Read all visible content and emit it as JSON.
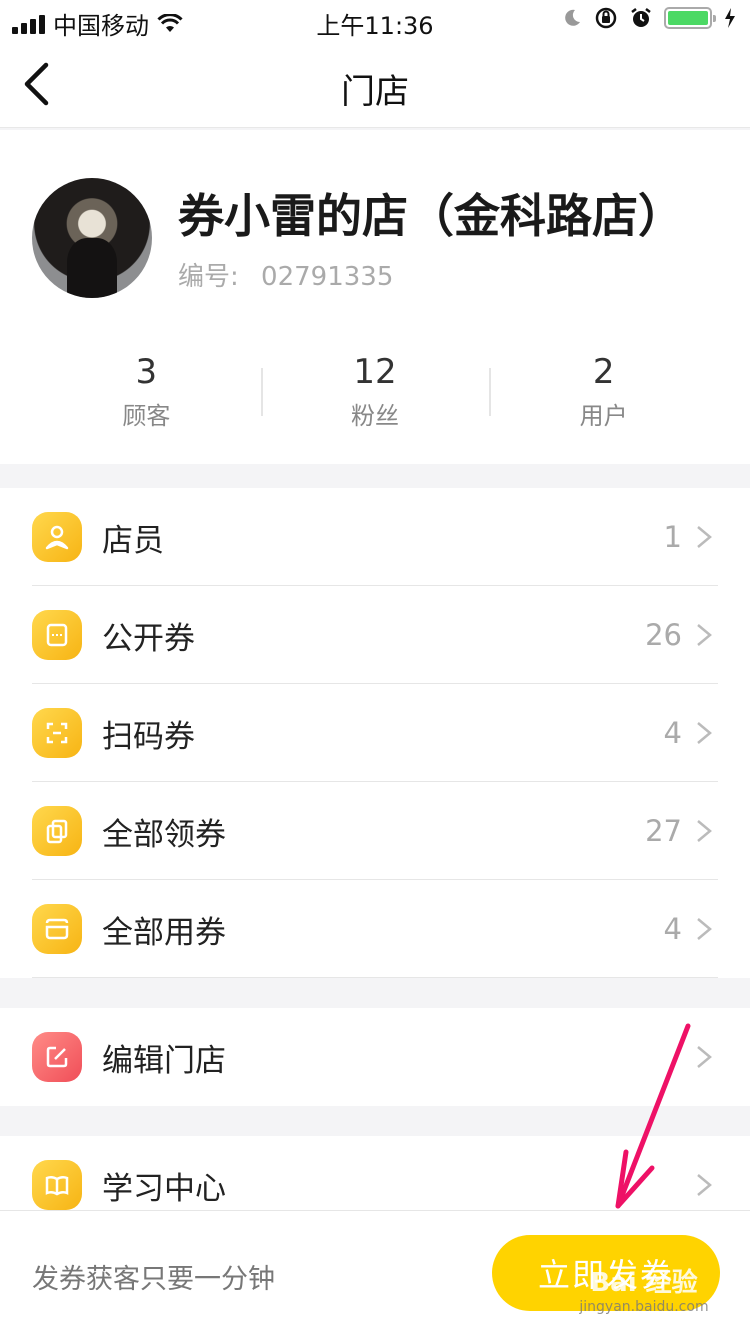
{
  "status_bar": {
    "carrier": "中国移动",
    "time": "上午11:36"
  },
  "nav": {
    "title": "门店"
  },
  "store": {
    "name": "券小雷的店（金科路店）",
    "id_label": "编号:",
    "id_value": "02791335",
    "stats": [
      {
        "value": "3",
        "label": "顾客"
      },
      {
        "value": "12",
        "label": "粉丝"
      },
      {
        "value": "2",
        "label": "用户"
      }
    ]
  },
  "menu": {
    "group1": [
      {
        "label": "店员",
        "count": "1",
        "icon": "user-icon"
      },
      {
        "label": "公开券",
        "count": "26",
        "icon": "ticket-icon"
      },
      {
        "label": "扫码券",
        "count": "4",
        "icon": "scan-icon"
      },
      {
        "label": "全部领券",
        "count": "27",
        "icon": "copy-icon"
      },
      {
        "label": "全部用券",
        "count": "4",
        "icon": "coupon-icon"
      }
    ],
    "group2": [
      {
        "label": "编辑门店",
        "icon": "edit-icon"
      }
    ],
    "group3": [
      {
        "label": "学习中心",
        "icon": "book-icon"
      }
    ]
  },
  "bottom": {
    "text": "发券获客只要一分钟",
    "button_label": "立即发券"
  },
  "watermark": {
    "text": "Bai 经验",
    "sub": "jingyan.baidu.com"
  },
  "colors": {
    "accent": "#ffd300",
    "icon_yellow": "#f7b414",
    "icon_red": "#f04e58",
    "annotation": "#ee1166"
  }
}
